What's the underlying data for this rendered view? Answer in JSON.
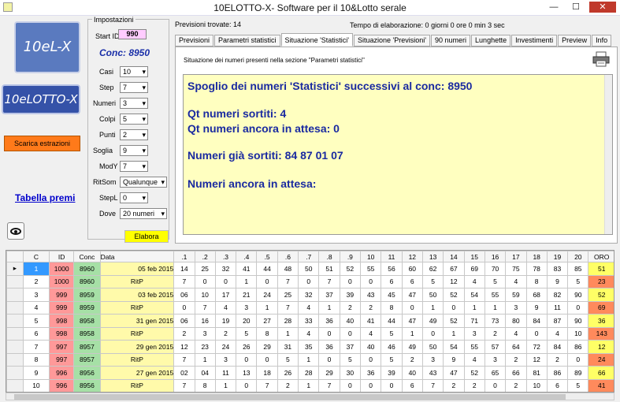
{
  "window": {
    "title": "10ELOTTO-X- Software per il 10&Lotto  serale",
    "minimize": "—",
    "maximize": "☐",
    "close": "✕"
  },
  "sidebar": {
    "logo_top": "10eL-X",
    "logo_bottom": "10eLOTTO-X",
    "download_button": "Scarica estrazioni",
    "table_link": "Tabella premi"
  },
  "settings": {
    "title": "Impostazioni",
    "start_id_label": "Start ID",
    "start_id_value": "990",
    "conc_label": "Conc: 8950",
    "fields": [
      {
        "label": "Casi",
        "value": "10"
      },
      {
        "label": "Step",
        "value": "7"
      },
      {
        "label": "Numeri",
        "value": "3"
      },
      {
        "label": "Colpi",
        "value": "5"
      },
      {
        "label": "Punti",
        "value": "2"
      },
      {
        "label": "Soglia",
        "value": "9"
      },
      {
        "label": "ModY",
        "value": "7"
      },
      {
        "label": "RitSom",
        "value": "Qualunque"
      },
      {
        "label": "StepL",
        "value": "0"
      },
      {
        "label": "Dove",
        "value": "20 numeri"
      }
    ],
    "elabora": "Elabora"
  },
  "status": {
    "found": "Previsioni trovate: 14",
    "time": "Tempo di elaborazione: 0 giorni 0 ore 0 min 3 sec"
  },
  "tabs": [
    "Previsioni",
    "Parametri statistici",
    "Situazione 'Statistici'",
    "Situazione 'Previsioni'",
    "90 numeri",
    "Lunghette",
    "Investimenti",
    "Preview",
    "Info"
  ],
  "active_tab": 2,
  "panel": {
    "caption": "Situazione dei numeri presenti nella sezione  \"Parametri statistici\"",
    "lines": [
      "Spoglio dei numeri 'Statistici' successivi al conc: 8950",
      "Qt numeri sortiti: 4",
      "Qt numeri ancora in attesa: 0",
      "Numeri già sortiti: 84 87 01 07",
      "Numeri ancora in attesa:"
    ],
    "colors": {
      "text": "#1a2aa0",
      "background": "#ffffc0"
    }
  },
  "grid": {
    "headers": [
      "",
      "C",
      "ID",
      "Conc",
      "Data",
      ".1",
      ".2",
      ".3",
      ".4",
      ".5",
      ".6",
      ".7",
      ".8",
      ".9",
      "10",
      "11",
      "12",
      "13",
      "14",
      "15",
      "16",
      "17",
      "18",
      "19",
      "20",
      "ORO"
    ],
    "rows": [
      {
        "c": "1",
        "id": "1000",
        "conc": "8960",
        "data": "05 feb 2015",
        "nums": [
          "14",
          "25",
          "32",
          "41",
          "44",
          "48",
          "50",
          "51",
          "52",
          "55",
          "56",
          "60",
          "62",
          "67",
          "69",
          "70",
          "75",
          "78",
          "83",
          "85"
        ],
        "oro": "51",
        "oro_color": "#ffff66"
      },
      {
        "c": "2",
        "id": "1000",
        "conc": "8960",
        "data": "RitP",
        "nums": [
          "7",
          "0",
          "0",
          "1",
          "0",
          "7",
          "0",
          "7",
          "0",
          "0",
          "6",
          "6",
          "5",
          "12",
          "4",
          "5",
          "4",
          "8",
          "9",
          "5"
        ],
        "oro": "23",
        "oro_color": "#ff8a5c"
      },
      {
        "c": "3",
        "id": "999",
        "conc": "8959",
        "data": "03 feb 2015",
        "nums": [
          "06",
          "10",
          "17",
          "21",
          "24",
          "25",
          "32",
          "37",
          "39",
          "43",
          "45",
          "47",
          "50",
          "52",
          "54",
          "55",
          "59",
          "68",
          "82",
          "90"
        ],
        "oro": "52",
        "oro_color": "#ffff66"
      },
      {
        "c": "4",
        "id": "999",
        "conc": "8959",
        "data": "RitP",
        "nums": [
          "0",
          "7",
          "4",
          "3",
          "1",
          "7",
          "4",
          "1",
          "2",
          "2",
          "8",
          "0",
          "1",
          "0",
          "1",
          "1",
          "3",
          "9",
          "11",
          "0"
        ],
        "oro": "69",
        "oro_color": "#ff8a5c"
      },
      {
        "c": "5",
        "id": "998",
        "conc": "8958",
        "data": "31 gen 2015",
        "nums": [
          "06",
          "16",
          "19",
          "20",
          "27",
          "28",
          "33",
          "36",
          "40",
          "41",
          "44",
          "47",
          "49",
          "52",
          "71",
          "73",
          "80",
          "84",
          "87",
          "90"
        ],
        "oro": "36",
        "oro_color": "#ffff66"
      },
      {
        "c": "6",
        "id": "998",
        "conc": "8958",
        "data": "RitP",
        "nums": [
          "2",
          "3",
          "2",
          "5",
          "8",
          "1",
          "4",
          "0",
          "0",
          "4",
          "5",
          "1",
          "0",
          "1",
          "3",
          "2",
          "4",
          "0",
          "4",
          "10"
        ],
        "oro": "143",
        "oro_color": "#ff8a5c"
      },
      {
        "c": "7",
        "id": "997",
        "conc": "8957",
        "data": "29 gen 2015",
        "nums": [
          "12",
          "23",
          "24",
          "26",
          "29",
          "31",
          "35",
          "36",
          "37",
          "40",
          "46",
          "49",
          "50",
          "54",
          "55",
          "57",
          "64",
          "72",
          "84",
          "86"
        ],
        "oro": "12",
        "oro_color": "#ffff66"
      },
      {
        "c": "8",
        "id": "997",
        "conc": "8957",
        "data": "RitP",
        "nums": [
          "7",
          "1",
          "3",
          "0",
          "0",
          "5",
          "1",
          "0",
          "5",
          "0",
          "5",
          "2",
          "3",
          "9",
          "4",
          "3",
          "2",
          "12",
          "2",
          "0"
        ],
        "oro": "24",
        "oro_color": "#ff8a5c"
      },
      {
        "c": "9",
        "id": "996",
        "conc": "8956",
        "data": "27 gen 2015",
        "nums": [
          "02",
          "04",
          "11",
          "13",
          "18",
          "26",
          "28",
          "29",
          "30",
          "36",
          "39",
          "40",
          "43",
          "47",
          "52",
          "65",
          "66",
          "81",
          "86",
          "89"
        ],
        "oro": "66",
        "oro_color": "#ffff66"
      },
      {
        "c": "10",
        "id": "996",
        "conc": "8956",
        "data": "RitP",
        "nums": [
          "7",
          "8",
          "1",
          "0",
          "7",
          "2",
          "1",
          "7",
          "0",
          "0",
          "0",
          "6",
          "7",
          "2",
          "2",
          "0",
          "2",
          "10",
          "6",
          "5"
        ],
        "oro": "41",
        "oro_color": "#ff8a5c"
      }
    ]
  }
}
